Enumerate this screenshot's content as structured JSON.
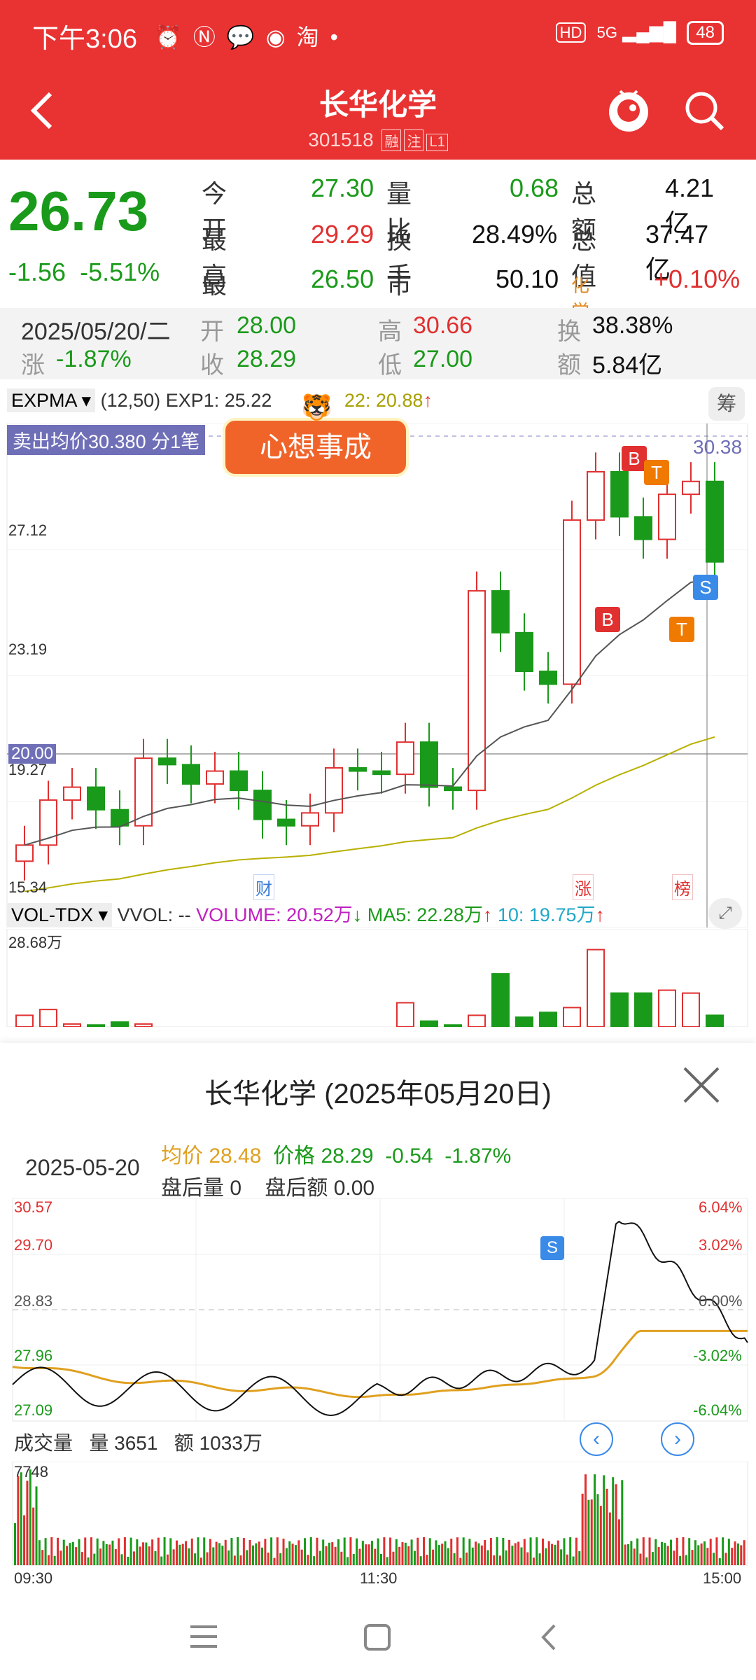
{
  "status_bar": {
    "time": "下午3:06",
    "icons": [
      "alarm-icon",
      "nfc-icon",
      "wechat-icon",
      "app-icon",
      "taobao-icon"
    ],
    "dot": "•",
    "hd": "HD",
    "network": "5G",
    "battery": "48"
  },
  "header": {
    "title": "长华化学",
    "code": "301518",
    "tags": [
      "融",
      "注",
      "L1"
    ]
  },
  "quote": {
    "price": "26.73",
    "change": "-1.56",
    "change_pct": "-5.51%",
    "rows": [
      {
        "l1": "今开",
        "v1": "27.30",
        "l2": "量比",
        "v2": "0.68",
        "l3": "总额",
        "v3": "4.21亿"
      },
      {
        "l1": "最高",
        "v1": "29.29",
        "l2": "换手",
        "v2": "28.49%",
        "l3": "总值",
        "v3": "37.47亿"
      },
      {
        "l1": "最低",
        "v1": "26.50",
        "l2": "市盈",
        "l2sup": "动",
        "v2": "50.10",
        "l3": "化学制品",
        "v3": "+0.10%"
      }
    ]
  },
  "day_bar": {
    "date": "2025/05/20/二",
    "open_l": "开",
    "open": "28.00",
    "high_l": "高",
    "high": "30.66",
    "turn_l": "换",
    "turn": "38.38%",
    "chg_l": "涨",
    "chg": "-1.87%",
    "close_l": "收",
    "close": "28.29",
    "low_l": "低",
    "low": "27.00",
    "amt_l": "额",
    "amt": "5.84亿"
  },
  "kline": {
    "indicator": "EXPMA",
    "params": "(12,50)",
    "exp1": "EXP1: 25.22",
    "exp2": "22: 20.88",
    "chip": "筹",
    "sell_label": "卖出均价30.380 分1笔",
    "sticker": "心想事成",
    "price_tag": "30.38",
    "axis": [
      "27.12",
      "23.19",
      "20.00",
      "19.27",
      "15.34"
    ],
    "markers": {
      "cai": "财",
      "zhang": "涨",
      "bang": "榜"
    },
    "candle_closes": [
      17.9,
      19.3,
      19.7,
      19.0,
      18.5,
      20.6,
      20.4,
      19.8,
      20.2,
      19.6,
      18.7,
      18.5,
      18.9,
      20.3,
      20.2,
      20.1,
      21.1,
      19.7,
      19.6,
      25.8,
      24.5,
      23.3,
      22.9,
      28.0,
      29.5,
      28.1,
      27.4,
      28.8,
      29.2,
      26.7
    ],
    "badges": [
      "B",
      "T",
      "B",
      "T",
      "S"
    ]
  },
  "vol": {
    "indicator": "VOL-TDX",
    "vvol": "VVOL: --",
    "volume": "VOLUME: 20.52万",
    "ma5": "MA5: 22.28万",
    "ma10": "10: 19.75万",
    "max": "28.68万"
  },
  "intraday": {
    "title": "长华化学 (2025年05月20日)",
    "date": "2025-05-20",
    "avg_l": "均价",
    "avg": "28.48",
    "price_l": "价格",
    "price": "28.29",
    "chg": "-0.54",
    "pct": "-1.87%",
    "after_vol_l": "盘后量",
    "after_vol": "0",
    "after_amt_l": "盘后额",
    "after_amt": "0.00",
    "left_axis": [
      "30.57",
      "29.70",
      "28.83",
      "27.96",
      "27.09"
    ],
    "right_axis": [
      "6.04%",
      "3.02%",
      "0.00%",
      "-3.02%",
      "-6.04%"
    ],
    "vol_label": "成交量",
    "vol_l": "量",
    "vol_v": "3651",
    "amt_l": "额",
    "amt_v": "1033万",
    "vol_max": "7748",
    "time_start": "09:30",
    "time_mid": "11:30",
    "time_end": "15:00",
    "s_badge": "S"
  },
  "colors": {
    "header": "#e93232",
    "up": "#e03030",
    "down": "#1a9a1a",
    "avg": "#e0a020"
  }
}
